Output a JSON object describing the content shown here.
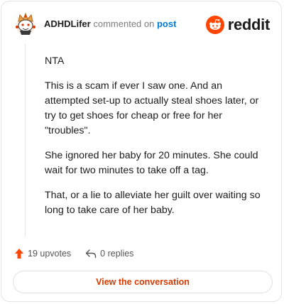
{
  "header": {
    "username": "ADHDLifer",
    "commented_text": "commented on",
    "post_link_label": "post",
    "logo_text": "reddit",
    "logo_color": "#ff4500"
  },
  "comment": {
    "paragraphs": [
      "NTA",
      "This is a scam if ever I saw one. And an attempted set-up to actually steal shoes later, or try to get shoes for cheap or free for her \"troubles\".",
      "She ignored her baby for 20 minutes. She could wait for two minutes to take off a tag.",
      "That, or a lie to alleviate her guilt over waiting so long to take care of her baby."
    ]
  },
  "actions": {
    "upvotes_label": "19 upvotes",
    "replies_label": "0 replies",
    "upvote_icon": "upvote-arrow-icon",
    "reply_icon": "reply-arrow-icon",
    "upvote_color": "#ff4500"
  },
  "footer": {
    "view_button_label": "View the conversation",
    "view_button_color": "#d93a00"
  }
}
